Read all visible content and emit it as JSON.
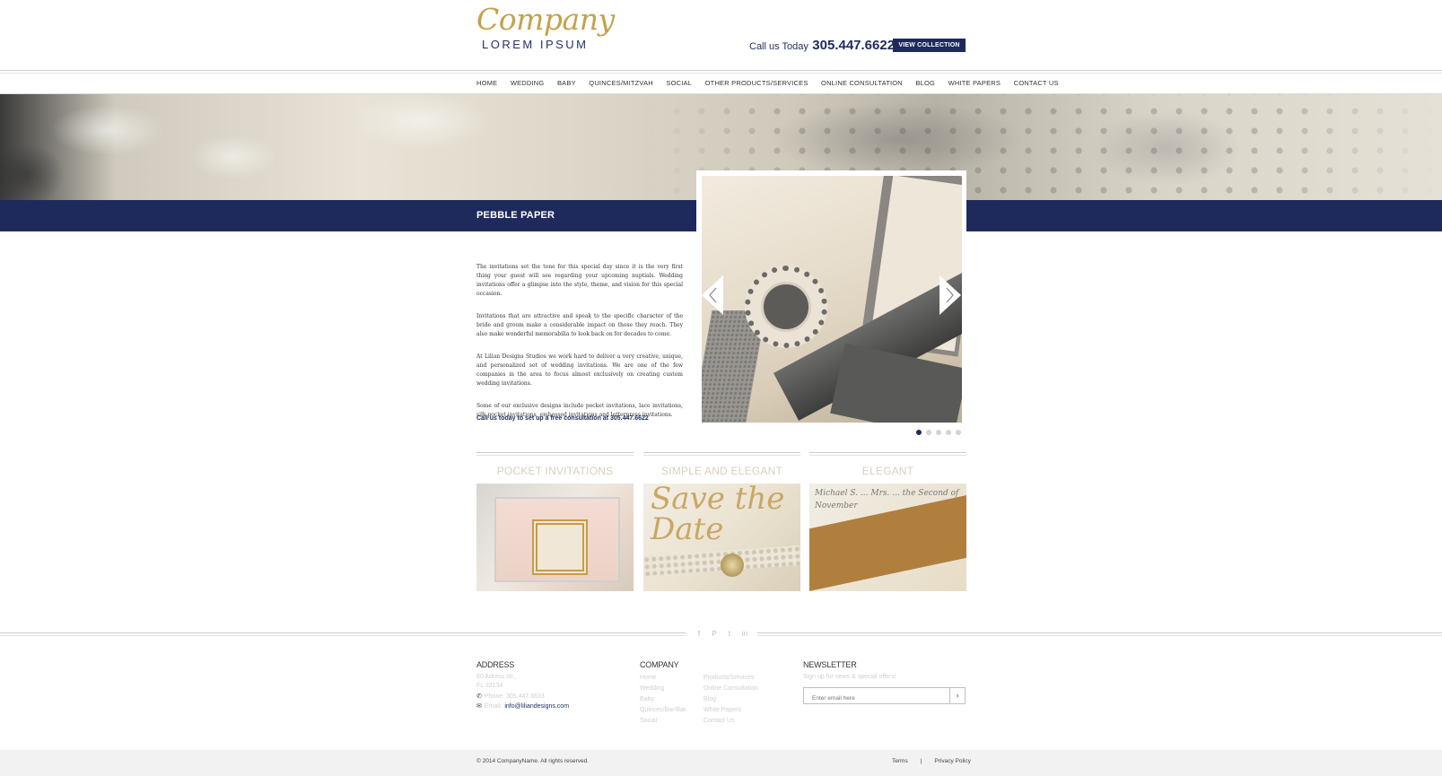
{
  "header": {
    "logo_script": "Company",
    "logo_sub": "LOREM IPSUM",
    "call_label": "Call us Today",
    "phone": "305.447.6622",
    "view_collection": "VIEW COLLECTION"
  },
  "nav": {
    "items": [
      "HOME",
      "WEDDING",
      "BABY",
      "QUINCES/MITZVAH",
      "SOCIAL",
      "OTHER PRODUCTS/SERVICES",
      "ONLINE CONSULTATION",
      "BLOG",
      "WHITE PAPERS",
      "CONTACT US"
    ]
  },
  "hero": {
    "title": "PEBBLE PAPER"
  },
  "content": {
    "paragraphs": [
      "The invitations set the tone for this special day since it is the very first thing your guest will see regarding your upcoming nuptials. Wedding invitations offer a glimpse into the style, theme, and vision for this special occasion.",
      "Invitations that are attractive and speak to the specific character of the bride and groom make a considerable impact on those they reach. They also make wonderful memorabilia to look back on for decades to come.",
      "At Lilian Designs Studios we work hard to deliver a very creative, unique, and personalized set of wedding invitations. We are one of the few companies in the area to focus almost exclusively on creating custom wedding invitations.",
      "Some of our exclusive designs include pocket invitations, lace invitations, silk pocket invitations, embossed invitations and letterpress invitations."
    ],
    "cta": "Call us today to set up a free consultation at 305.447.6622"
  },
  "slider": {
    "slide_count": 5,
    "active_index": 0
  },
  "features": [
    {
      "title": "POCKET INVITATIONS"
    },
    {
      "title": "SIMPLE AND ELEGANT"
    },
    {
      "title": "ELEGANT"
    }
  ],
  "feature_images": {
    "save_date_script": "Save the Date",
    "elegant_script": "Michael S. ... Mrs. ... the Second of November"
  },
  "social": [
    "facebook-icon",
    "pinterest-icon",
    "twitter-icon",
    "linkedin-icon"
  ],
  "footer": {
    "address_heading": "ADDRESS",
    "address_line1": "60 Adress str.,",
    "address_line2": "FL 33134",
    "phone": "Phone: 305.447.6633",
    "email_label": "Email:",
    "email": "info@liliandesigns.com",
    "company_heading": "COMPANY",
    "company_links_1": [
      "Home",
      "Wedding",
      "Baby",
      "Quinces/Bar/Bat",
      "Social"
    ],
    "company_links_2": [
      "Products/Services",
      "Online Consultation",
      "Blog",
      "White Papers",
      "Contact Us"
    ],
    "newsletter_heading": "NEWSLETTER",
    "newsletter_sub": "Sign up for news & special offers!",
    "email_placeholder": "Enter email here",
    "submit_glyph": "›"
  },
  "bottom": {
    "copyright": "© 2014 CompanyName. All rights reserved.",
    "terms": "Terms",
    "divider": "|",
    "privacy": "Privacy Policy"
  },
  "colors": {
    "navy": "#1f2a5c",
    "gold": "#c4a24a",
    "muted_title": "#d8d1bd"
  }
}
